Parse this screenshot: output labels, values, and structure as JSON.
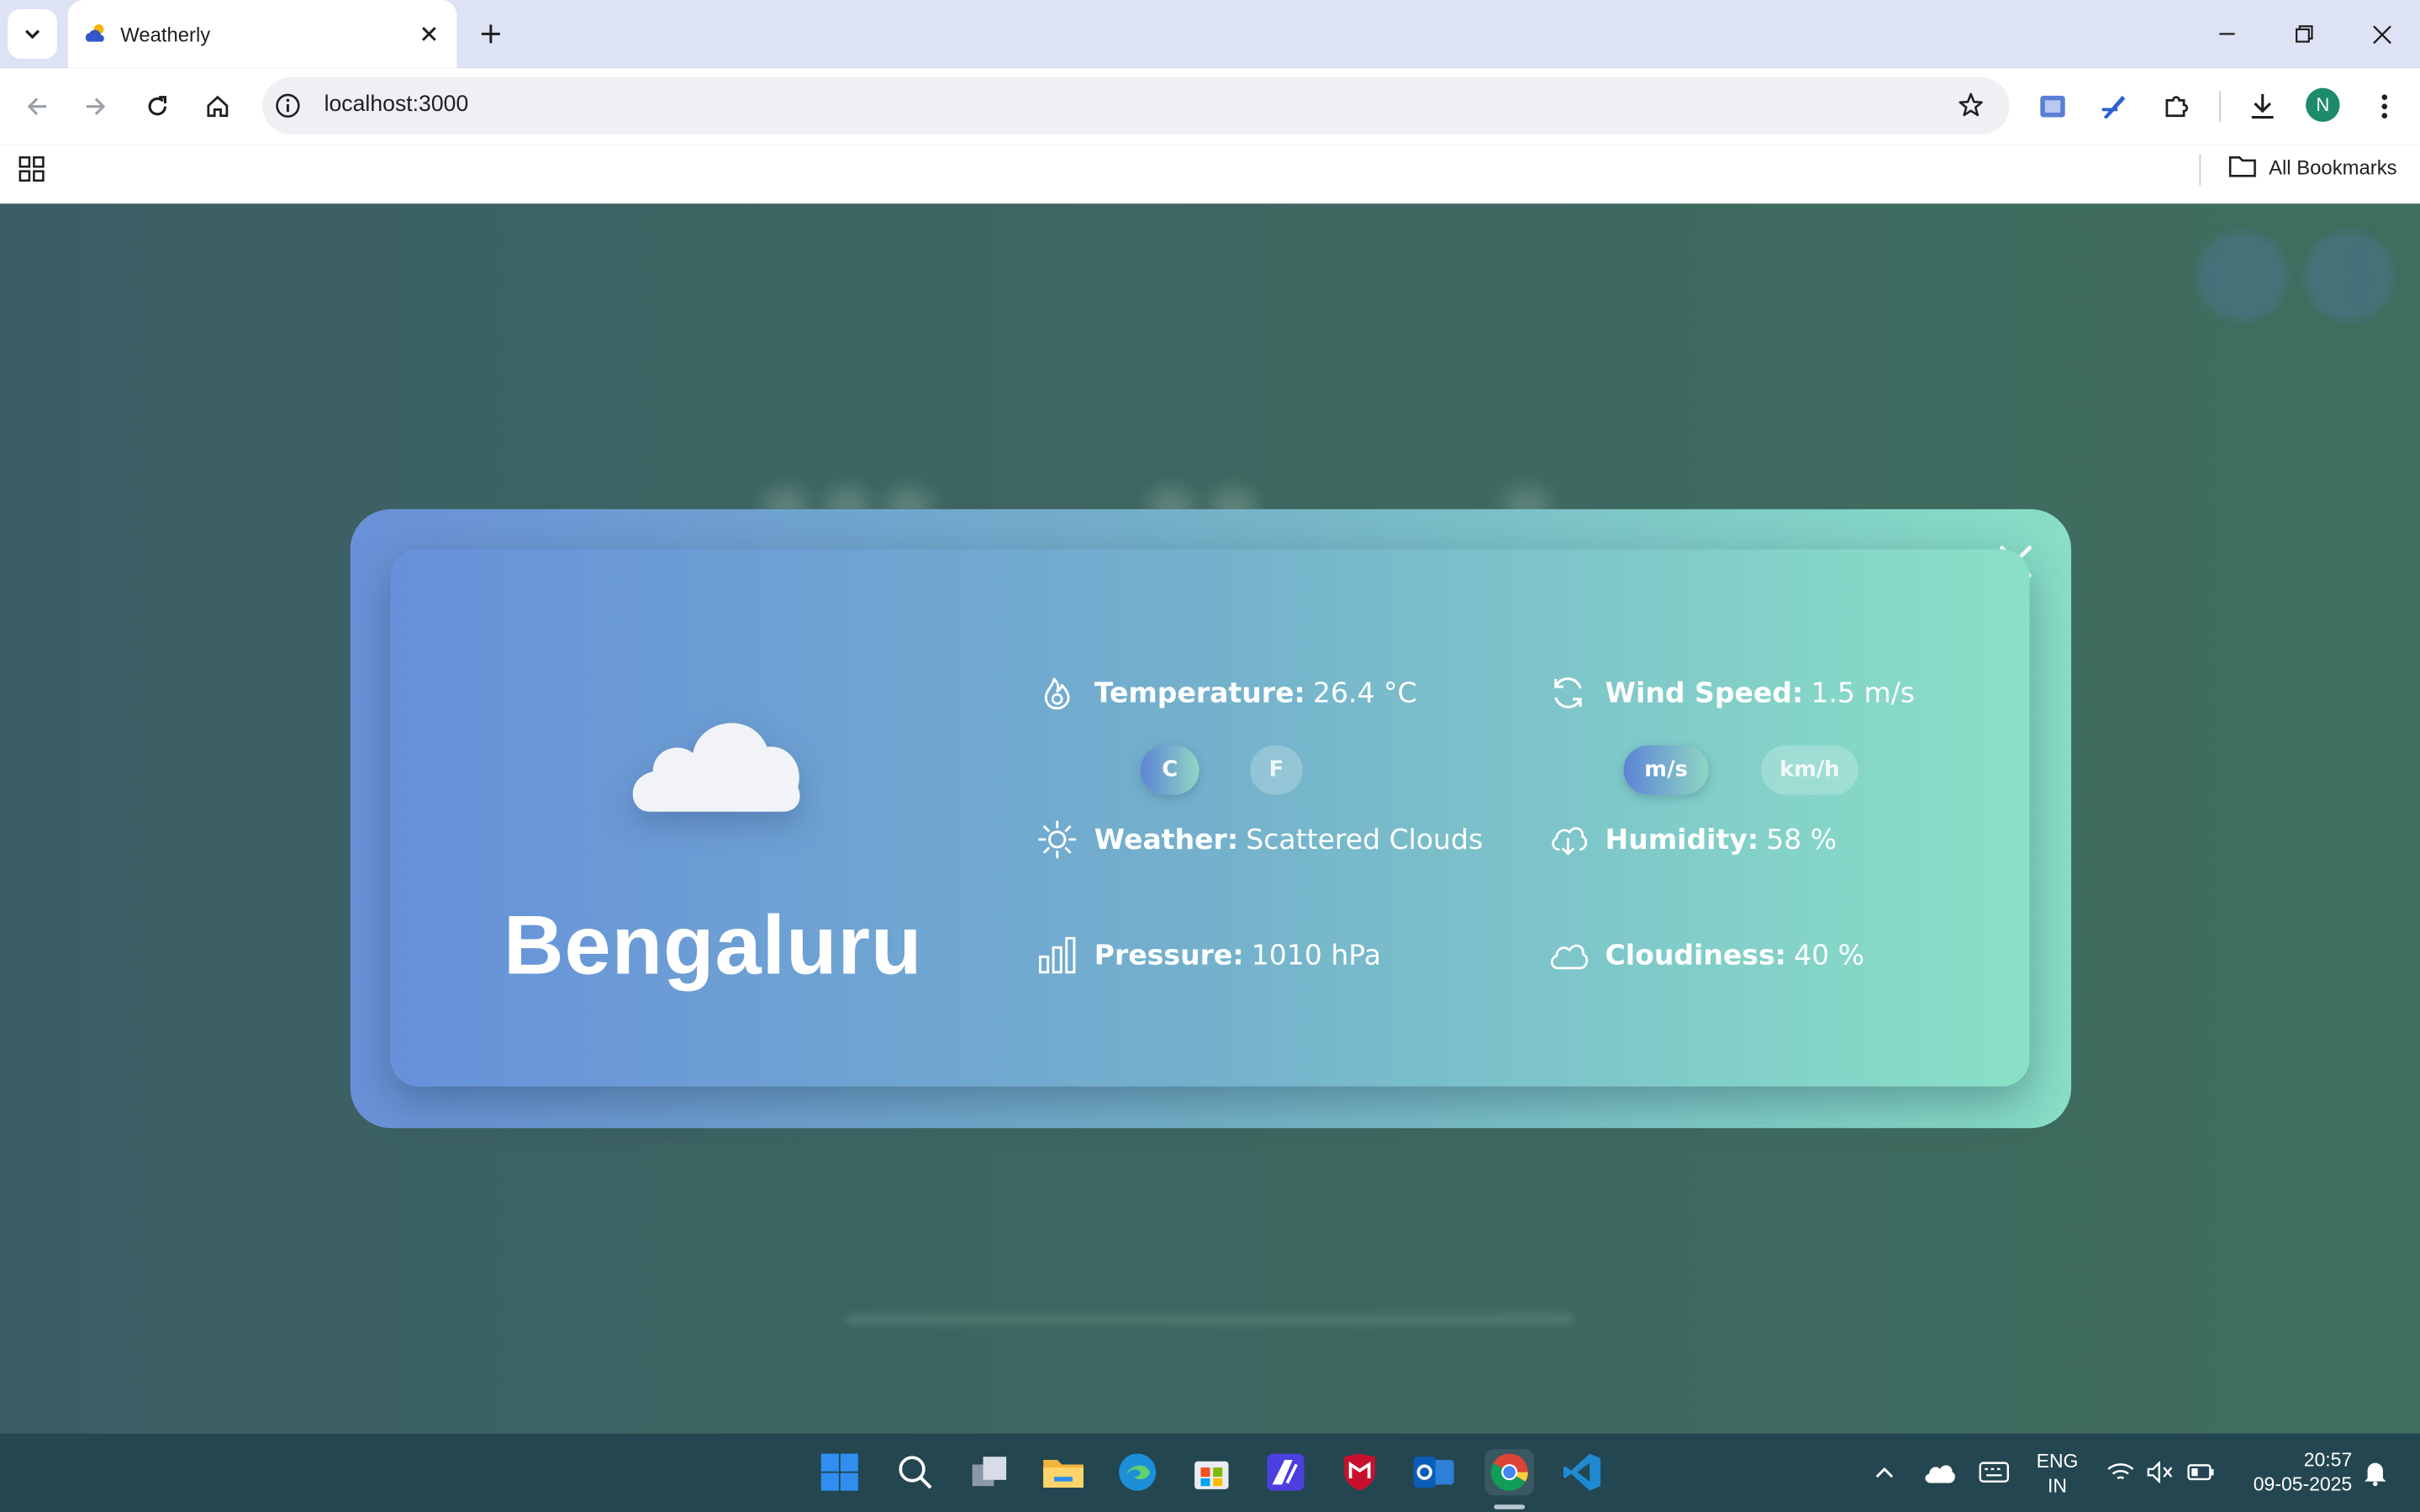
{
  "browser": {
    "tab_title": "Weatherly",
    "url": "localhost:3000",
    "all_bookmarks": "All Bookmarks",
    "profile_initial": "N"
  },
  "weather": {
    "city": "Bengaluru",
    "icon": "cloud-icon",
    "temperature": {
      "label": "Temperature:",
      "value": "26.4 °C",
      "units": [
        "C",
        "F"
      ],
      "active_unit": "C"
    },
    "wind_speed": {
      "label": "Wind Speed:",
      "value": "1.5 m/s",
      "units": [
        "m/s",
        "km/h"
      ],
      "active_unit": "m/s"
    },
    "condition": {
      "label": "Weather:",
      "value": "Scattered Clouds"
    },
    "humidity": {
      "label": "Humidity:",
      "value": "58 %"
    },
    "pressure": {
      "label": "Pressure:",
      "value": "1010 hPa"
    },
    "cloudiness": {
      "label": "Cloudiness:",
      "value": "40 %"
    }
  },
  "taskbar": {
    "language": "ENG",
    "region": "IN",
    "time": "20:57",
    "date": "09-05-2025"
  },
  "colors": {
    "modal_start": "#6791da",
    "modal_end": "#8ae0c6",
    "page_background": "#3e6760",
    "taskbar": "#244650"
  }
}
